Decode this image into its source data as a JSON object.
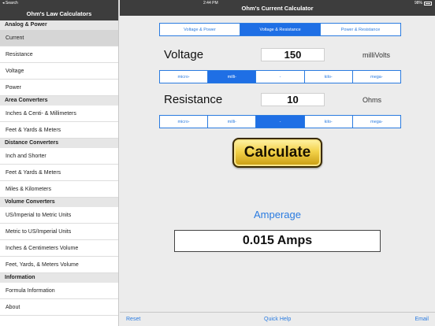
{
  "status": {
    "left": "Search",
    "time": "2:44 PM",
    "battery": "98%"
  },
  "sidebar": {
    "title": "Ohm's Law Calculators",
    "sections": [
      {
        "heading": "Analog & Power",
        "items": [
          "Current",
          "Resistance",
          "Voltage",
          "Power"
        ]
      },
      {
        "heading": "Area Converters",
        "items": [
          "Inches & Centi- & Millimeters",
          "Feet & Yards & Meters"
        ]
      },
      {
        "heading": "Distance Converters",
        "items": [
          "Inch and Shorter",
          "Feet & Yards & Meters",
          "Miles & Kilometers"
        ]
      },
      {
        "heading": "Volume Converters",
        "items": [
          "US/Imperial to Metric Units",
          "Metric to US/Imperial Units",
          "Inches & Centimeters Volume",
          "Feet, Yards, & Meters Volume"
        ]
      },
      {
        "heading": "Information",
        "items": [
          "Formula Information",
          "About"
        ]
      }
    ],
    "selected": "Current"
  },
  "main": {
    "title": "Ohm's Current Calculator",
    "mode_tabs": [
      "Voltage & Power",
      "Voltage & Resistance",
      "Power & Resistance"
    ],
    "mode_selected": 1,
    "voltage": {
      "label": "Voltage",
      "value": "150",
      "unit": "milliVolts"
    },
    "resistance": {
      "label": "Resistance",
      "value": "10",
      "unit": "Ohms"
    },
    "prefixes": [
      "micro-",
      "milli-",
      "-",
      "kilo-",
      "mega-"
    ],
    "voltage_prefix_selected": 1,
    "resistance_prefix_selected": 2,
    "calculate_label": "Calculate",
    "result_label": "Amperage",
    "result_value": "0.015 Amps",
    "accent_color": "#2a7be0"
  },
  "toolbar": {
    "reset": "Reset",
    "help": "Quick Help",
    "email": "Email"
  }
}
